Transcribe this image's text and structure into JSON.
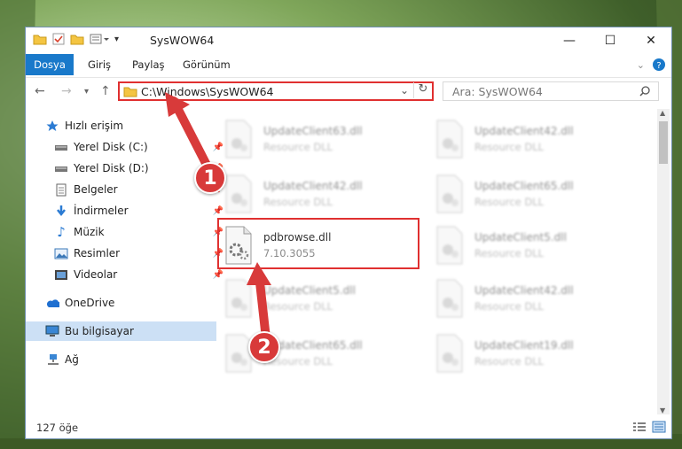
{
  "window": {
    "title": "SysWOW64",
    "controls": {
      "minimize": "—",
      "maximize": "☐",
      "close": "✕"
    }
  },
  "ribbon": {
    "tabs": [
      {
        "label": "Dosya"
      },
      {
        "label": "Giriş"
      },
      {
        "label": "Paylaş"
      },
      {
        "label": "Görünüm"
      }
    ]
  },
  "navigation": {
    "address": "C:\\Windows\\SysWOW64",
    "search_placeholder": "Ara: SysWOW64"
  },
  "sidebar": {
    "items": [
      {
        "label": "Hızlı erişim",
        "icon": "star-icon"
      },
      {
        "label": "Yerel Disk (C:)",
        "icon": "drive-icon",
        "pinned": true
      },
      {
        "label": "Yerel Disk (D:)",
        "icon": "drive-icon",
        "pinned": true
      },
      {
        "label": "Belgeler",
        "icon": "document-icon",
        "pinned": true
      },
      {
        "label": "İndirmeler",
        "icon": "download-icon",
        "pinned": true
      },
      {
        "label": "Müzik",
        "icon": "music-icon",
        "pinned": true
      },
      {
        "label": "Resimler",
        "icon": "pictures-icon",
        "pinned": true
      },
      {
        "label": "Videolar",
        "icon": "video-icon",
        "pinned": true
      },
      {
        "label": "OneDrive",
        "icon": "cloud-icon"
      },
      {
        "label": "Bu bilgisayar",
        "icon": "computer-icon",
        "selected": true
      },
      {
        "label": "Ağ",
        "icon": "network-icon"
      }
    ]
  },
  "files": [
    {
      "name": "UpdateClient63.dll",
      "desc": "Resource DLL"
    },
    {
      "name": "UpdateClient42.dll",
      "desc": "Resource DLL"
    },
    {
      "name": "UpdateClient42.dll",
      "desc": "Resource DLL"
    },
    {
      "name": "UpdateClient65.dll",
      "desc": "Resource DLL"
    },
    {
      "name": "pdbrowse.dll",
      "desc": "7.10.3055"
    },
    {
      "name": "UpdateClient5.dll",
      "desc": "Resource DLL"
    },
    {
      "name": "UpdateClient5.dll",
      "desc": "Resource DLL"
    },
    {
      "name": "UpdateClient42.dll",
      "desc": "Resource DLL"
    },
    {
      "name": "UpdateClient65.dll",
      "desc": "Resource DLL"
    },
    {
      "name": "UpdateClient19.dll",
      "desc": "Resource DLL"
    }
  ],
  "status": {
    "count": "127 öğe"
  },
  "annotations": {
    "badge1": "1",
    "badge2": "2"
  },
  "colors": {
    "accent": "#1979ca",
    "highlight": "#e03030",
    "badge": "#d83a3a"
  }
}
